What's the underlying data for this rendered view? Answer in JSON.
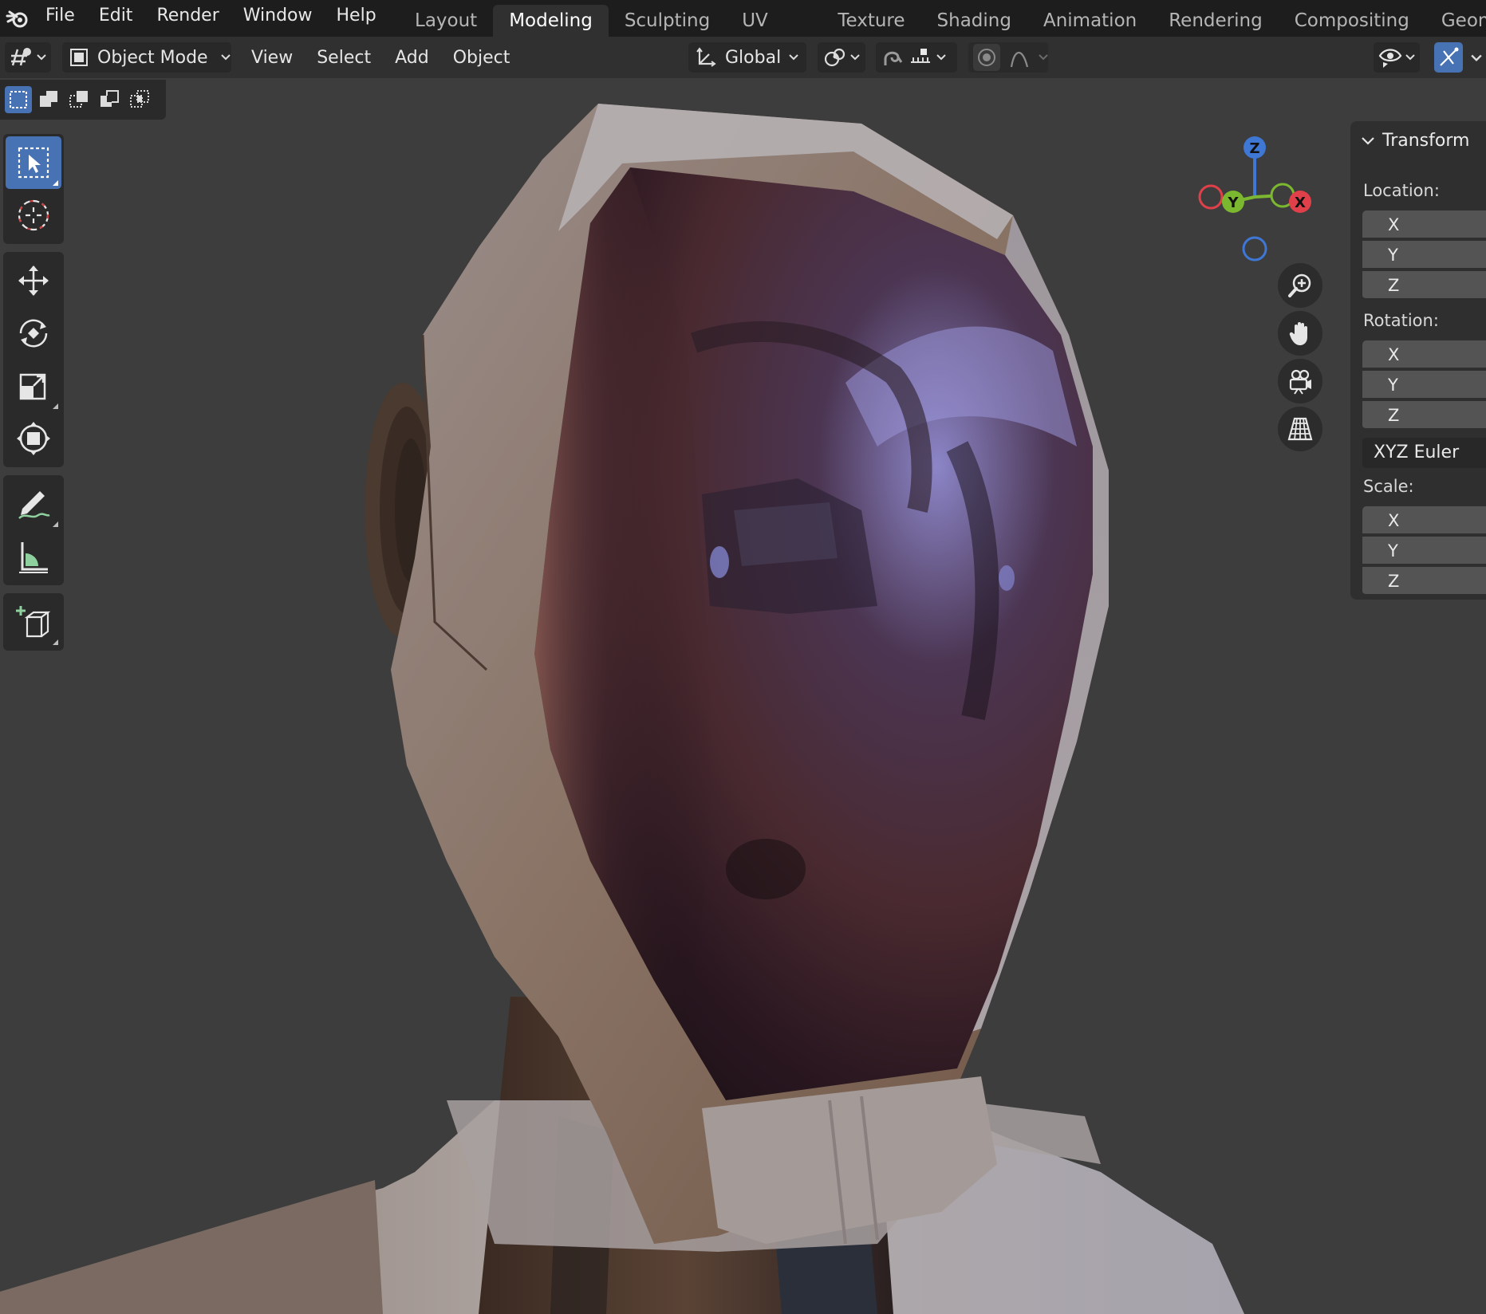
{
  "menu": [
    "File",
    "Edit",
    "Render",
    "Window",
    "Help"
  ],
  "workspaces": [
    "Layout",
    "Modeling",
    "Sculpting",
    "UV Editing",
    "Texture Paint",
    "Shading",
    "Animation",
    "Rendering",
    "Compositing",
    "Geome"
  ],
  "active_workspace": "Modeling",
  "header": {
    "mode": "Object Mode",
    "menus": [
      "View",
      "Select",
      "Add",
      "Object"
    ],
    "transform_orientation": "Global"
  },
  "gizmo": {
    "z": "Z",
    "y": "Y",
    "x": "X"
  },
  "npanel": {
    "title": "Transform",
    "location_label": "Location:",
    "rotation_label": "Rotation:",
    "scale_label": "Scale:",
    "rotation_mode": "XYZ Euler",
    "axes": [
      "X",
      "Y",
      "Z"
    ]
  },
  "icons": {
    "tools": [
      "select-box-icon",
      "cursor-icon",
      "move-icon",
      "rotate-icon",
      "scale-icon",
      "transform-icon",
      "annotate-icon",
      "measure-icon",
      "add-cube-icon"
    ],
    "nav": [
      "zoom-icon",
      "pan-hand-icon",
      "camera-icon",
      "perspective-grid-icon"
    ]
  },
  "colors": {
    "accent": "#4772b3",
    "axis_x": "#e0404a",
    "axis_y": "#7cb82f",
    "axis_z": "#3f77d5"
  }
}
